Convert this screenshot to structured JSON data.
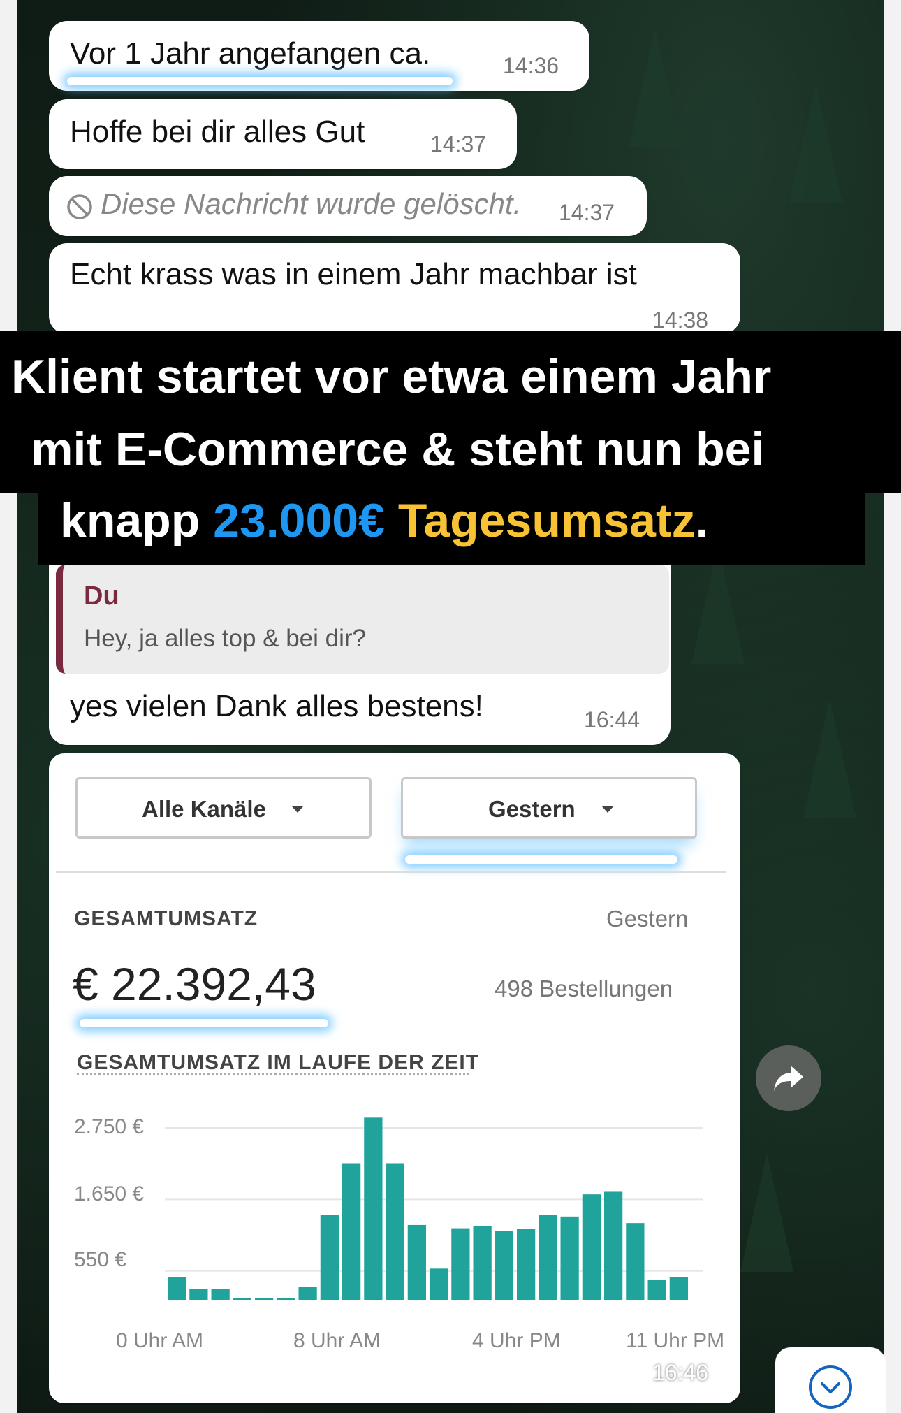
{
  "messages": [
    {
      "text": "Vor 1 Jahr angefangen ca.",
      "time": "14:36"
    },
    {
      "text": "Hoffe bei dir alles Gut",
      "time": "14:37"
    },
    {
      "text": "Diese Nachricht wurde gelöscht.",
      "time": "14:37",
      "deleted": true
    },
    {
      "text": "Echt krass was in einem Jahr machbar ist",
      "time": "14:38"
    }
  ],
  "banner": {
    "line1": "Klient startet vor etwa einem Jahr",
    "line2": "mit E-Commerce & steht nun bei",
    "line3_prefix": "knapp ",
    "line3_amount": "23.000€",
    "line3_word": "Tagesumsatz",
    "line3_suffix": ".",
    "colors": {
      "amount": "#1e97f3",
      "word": "#f7c234"
    }
  },
  "reply": {
    "quote_author": "Du",
    "quote_text": "Hey, ja alles top & bei dir?",
    "text": "yes vielen Dank alles bestens!",
    "time": "16:44"
  },
  "stats": {
    "channels_dropdown": "Alle Kanäle",
    "date_dropdown": "Gestern",
    "total_label": "GESAMTUMSATZ",
    "period_label": "Gestern",
    "total_amount": "€ 22.392,43",
    "orders": "498 Bestellungen",
    "chart_heading": "GESAMTUMSATZ IM LAUFE DER ZEIT",
    "time": "16:46"
  },
  "chart_data": {
    "type": "bar",
    "y_ticks": [
      "2.750 €",
      "1.650 €",
      "550 €"
    ],
    "x_ticks": [
      "0 Uhr AM",
      "8 Uhr AM",
      "4 Uhr PM",
      "11 Uhr PM"
    ],
    "ylim": [
      0,
      2900
    ],
    "color": "#1fa39b",
    "values": [
      350,
      170,
      170,
      20,
      20,
      20,
      200,
      1300,
      2100,
      2800,
      2100,
      1150,
      480,
      1100,
      1130,
      1060,
      1090,
      1300,
      1280,
      1620,
      1660,
      1180,
      310,
      350
    ]
  },
  "icons": {
    "blocked": "blocked-icon",
    "share": "share-icon",
    "scroll": "chevron-down-icon"
  }
}
